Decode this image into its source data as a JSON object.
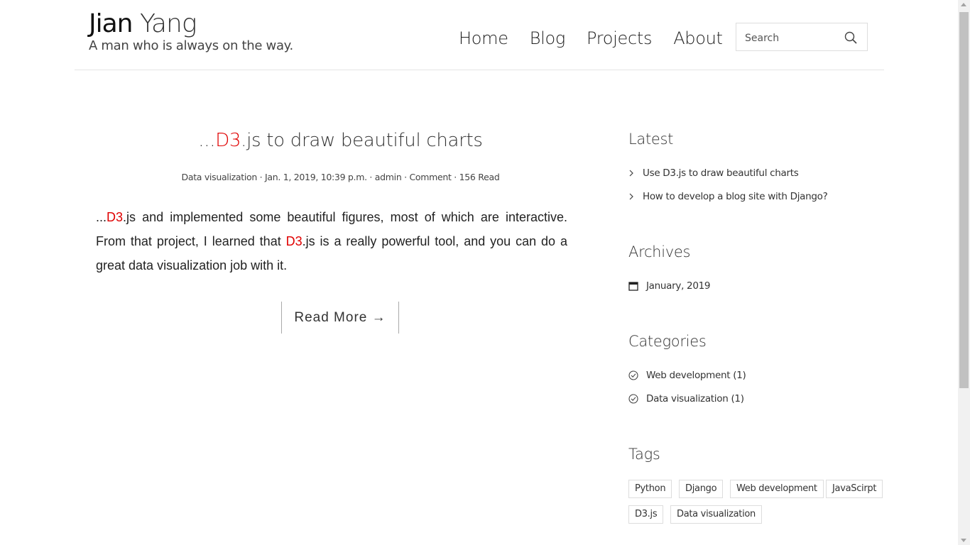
{
  "brand": {
    "first": "Jian",
    "last": " Yang",
    "tagline": "A man who is always on the way."
  },
  "nav": [
    {
      "label": "Home"
    },
    {
      "label": "Blog"
    },
    {
      "label": "Projects"
    },
    {
      "label": "About"
    }
  ],
  "search": {
    "placeholder": "Search",
    "icon": "search-icon"
  },
  "post": {
    "title_prefix": "...",
    "title_highlight": "D3",
    "title_suffix": ".js to draw beautiful charts",
    "meta": "Data visualization · Jan. 1, 2019, 10:39 p.m. · admin · Comment · 156 Read",
    "excerpt_1": "...",
    "excerpt_hl_1": "D3",
    "excerpt_2": ".js and implemented some beautiful figures, most of which are interactive. From that project, I learned that ",
    "excerpt_hl_2": "D3",
    "excerpt_3": ".js is a really powerful tool, and you can do a great data visualization job with it.",
    "read_more": "Read More →",
    "highlight_color": "#e00000"
  },
  "sidebar": {
    "latest": {
      "title": "Latest",
      "items": [
        {
          "label": "Use D3.js to draw beautiful charts"
        },
        {
          "label": "How to develop a blog site with Django?"
        }
      ]
    },
    "archives": {
      "title": "Archives",
      "items": [
        {
          "label": "January, 2019"
        }
      ]
    },
    "categories": {
      "title": "Categories",
      "items": [
        {
          "label": "Web development (1)"
        },
        {
          "label": "Data visualization (1)"
        }
      ]
    },
    "tags": {
      "title": "Tags",
      "items": [
        {
          "label": "Python"
        },
        {
          "label": "Django"
        },
        {
          "label": "Web development"
        },
        {
          "label": "JavaScirpt"
        },
        {
          "label": "D3.js"
        },
        {
          "label": "Data visualization"
        }
      ]
    }
  }
}
